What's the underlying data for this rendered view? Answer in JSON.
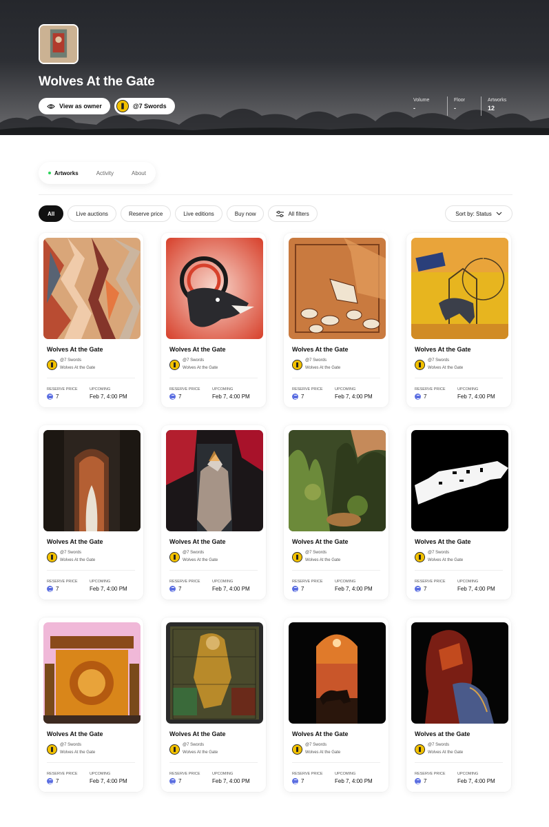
{
  "collection": {
    "title": "Wolves At the Gate",
    "view_as_owner_label": "View as owner",
    "creator_handle": "@7 Swords"
  },
  "stats": [
    {
      "label": "Volume",
      "value": "-"
    },
    {
      "label": "Floor",
      "value": "-"
    },
    {
      "label": "Artworks",
      "value": "12"
    }
  ],
  "tabs": [
    {
      "label": "Artworks",
      "active": true
    },
    {
      "label": "Activity",
      "active": false
    },
    {
      "label": "About",
      "active": false
    }
  ],
  "filters": [
    "All",
    "Live auctions",
    "Reserve price",
    "Live editions",
    "Buy now",
    "All filters"
  ],
  "sort_label": "Sort by: Status",
  "cards": [
    {
      "title": "Wolves At the Gate",
      "creator": "@7 Swords",
      "collection": "Wolves At the Gate",
      "price_label": "RESERVE PRICE",
      "price": "7",
      "status_label": "UPCOMING",
      "date": "Feb 7, 4:00 PM"
    },
    {
      "title": "Wolves At the Gate",
      "creator": "@7 Swords",
      "collection": "Wolves At the Gate",
      "price_label": "RESERVE PRICE",
      "price": "7",
      "status_label": "UPCOMING",
      "date": "Feb 7, 4:00 PM"
    },
    {
      "title": "Wolves At the Gate",
      "creator": "@7 Swords",
      "collection": "Wolves At the Gate",
      "price_label": "RESERVE PRICE",
      "price": "7",
      "status_label": "UPCOMING",
      "date": "Feb 7, 4:00 PM"
    },
    {
      "title": "Wolves At the Gate",
      "creator": "@7 Swords",
      "collection": "Wolves At the Gate",
      "price_label": "RESERVE PRICE",
      "price": "7",
      "status_label": "UPCOMING",
      "date": "Feb 7, 4:00 PM"
    },
    {
      "title": "Wolves At the Gate",
      "creator": "@7 Swords",
      "collection": "Wolves At the Gate",
      "price_label": "RESERVE PRICE",
      "price": "7",
      "status_label": "UPCOMING",
      "date": "Feb 7, 4:00 PM"
    },
    {
      "title": "Wolves At the Gate",
      "creator": "@7 Swords",
      "collection": "Wolves At the Gate",
      "price_label": "RESERVE PRICE",
      "price": "7",
      "status_label": "UPCOMING",
      "date": "Feb 7, 4:00 PM"
    },
    {
      "title": "Wolves At the Gate",
      "creator": "@7 Swords",
      "collection": "Wolves At the Gate",
      "price_label": "RESERVE PRICE",
      "price": "7",
      "status_label": "UPCOMING",
      "date": "Feb 7, 4:00 PM"
    },
    {
      "title": "Wolves At the Gate",
      "creator": "@7 Swords",
      "collection": "Wolves At the Gate",
      "price_label": "RESERVE PRICE",
      "price": "7",
      "status_label": "UPCOMING",
      "date": "Feb 7, 4:00 PM"
    },
    {
      "title": "Wolves At the Gate",
      "creator": "@7 Swords",
      "collection": "Wolves At the Gate",
      "price_label": "RESERVE PRICE",
      "price": "7",
      "status_label": "UPCOMING",
      "date": "Feb 7, 4:00 PM"
    },
    {
      "title": "Wolves At the Gate",
      "creator": "@7 Swords",
      "collection": "Wolves At the Gate",
      "price_label": "RESERVE PRICE",
      "price": "7",
      "status_label": "UPCOMING",
      "date": "Feb 7, 4:00 PM"
    },
    {
      "title": "Wolves At the Gate",
      "creator": "@7 Swords",
      "collection": "Wolves At the Gate",
      "price_label": "RESERVE PRICE",
      "price": "7",
      "status_label": "UPCOMING",
      "date": "Feb 7, 4:00 PM"
    },
    {
      "title": "Wolves at the Gate",
      "creator": "@7 Swords",
      "collection": "Wolves At the Gate",
      "price_label": "RESERVE PRICE",
      "price": "7",
      "status_label": "UPCOMING",
      "date": "Feb 7, 4:00 PM"
    }
  ],
  "icons": {
    "owner": "eye-icon",
    "filters": "sliders-icon",
    "sort": "chevron-down-icon",
    "currency": "eth-icon"
  },
  "colors": {
    "active_dot": "#2bd45a",
    "chip_active": "#111111",
    "avatar": "#f2c100",
    "currency": "#5b6ee1"
  }
}
